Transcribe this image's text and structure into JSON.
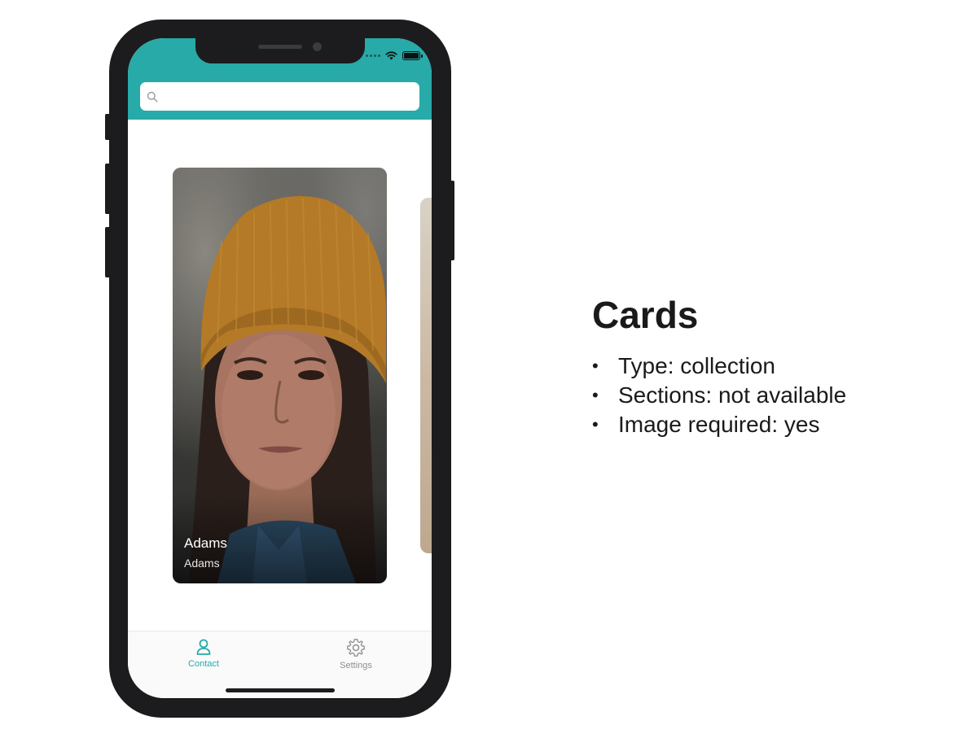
{
  "app": {
    "search": {
      "placeholder": "",
      "value": ""
    },
    "card": {
      "name": "Adams",
      "subtitle": "Adams"
    },
    "tabs": [
      {
        "label": "Contact",
        "icon": "person-icon",
        "active": true
      },
      {
        "label": "Settings",
        "icon": "gear-icon",
        "active": false
      }
    ],
    "colors": {
      "accent": "#27aaa8",
      "inactive": "#8e8e8e"
    }
  },
  "description": {
    "title": "Cards",
    "items": [
      "Type: collection",
      "Sections: not available",
      "Image required: yes"
    ]
  }
}
